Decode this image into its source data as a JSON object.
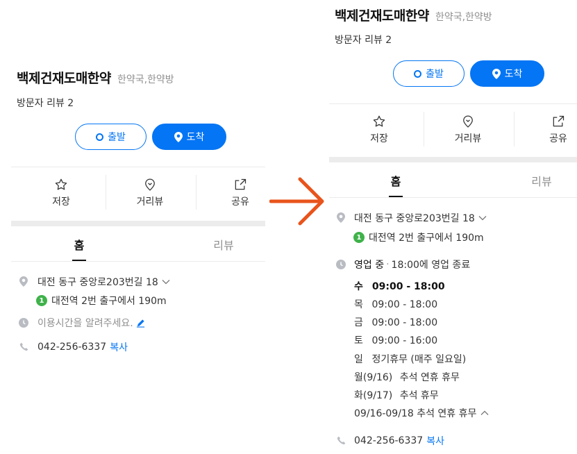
{
  "colors": {
    "accent": "#0475f4",
    "badge_green": "#3fb24a",
    "arrow": "#e8541c"
  },
  "place": {
    "name": "백제건재도매한약",
    "category": "한약국,한약방",
    "reviews": "방문자 리뷰 2"
  },
  "buttons": {
    "depart": "출발",
    "arrive": "도착"
  },
  "actions": {
    "save": "저장",
    "roadview": "거리뷰",
    "share": "공유"
  },
  "tabs": {
    "home": "홈",
    "review": "리뷰"
  },
  "address": {
    "text": "대전 동구 중앙로203번길 18",
    "station_badge": "1",
    "station": "대전역 2번 출구에서 190m"
  },
  "left": {
    "hours_prompt": "이용시간을 알려주세요."
  },
  "phone": {
    "number": "042-256-6337",
    "copy": "복사"
  },
  "hours": {
    "status": "영업 중",
    "closing": "18:00에 영업 종료",
    "days": [
      {
        "day": "수",
        "time": "09:00 - 18:00"
      },
      {
        "day": "목",
        "time": "09:00 - 18:00"
      },
      {
        "day": "금",
        "time": "09:00 - 18:00"
      },
      {
        "day": "토",
        "time": "09:00 - 16:00"
      },
      {
        "day": "일",
        "time": "정기휴무 (매주 일요일)"
      },
      {
        "day": "월(9/16)",
        "time": "추석 연휴 휴무"
      },
      {
        "day": "화(9/17)",
        "time": "추석 휴무"
      }
    ],
    "holiday_note": "09/16-09/18 추석 연휴 휴무"
  }
}
